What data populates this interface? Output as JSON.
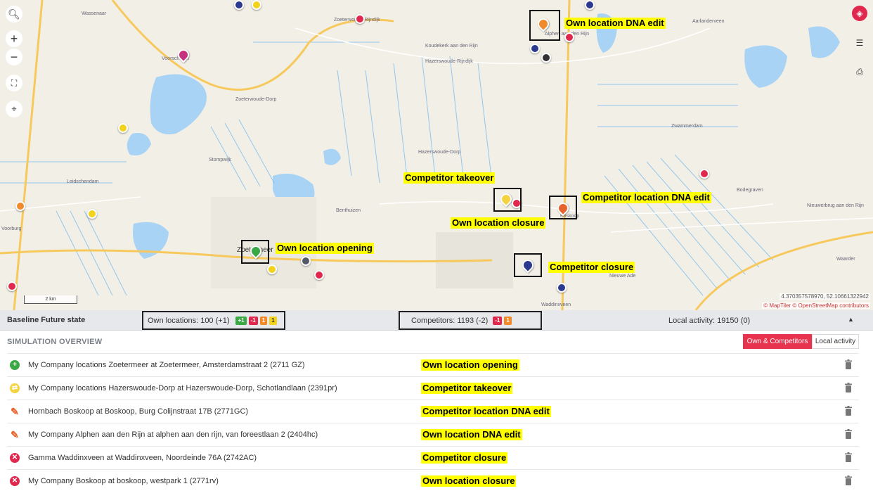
{
  "map": {
    "place_labels": [
      {
        "text": "Wassenaar"
      },
      {
        "text": "Voorschoten"
      },
      {
        "text": "Zoeterwoude-Rijndijk"
      },
      {
        "text": "Zoeterwoude-Dorp"
      },
      {
        "text": "Koudekerk aan den Rijn"
      },
      {
        "text": "Hazerswoude-Rijndijk"
      },
      {
        "text": "Aarlanderveen"
      },
      {
        "text": "Zwammerdam"
      },
      {
        "text": "Hazerswoude-Dorp"
      },
      {
        "text": "Stompwijk"
      },
      {
        "text": "Leidschendam"
      },
      {
        "text": "Voorburg"
      },
      {
        "text": "Benthuizen"
      },
      {
        "text": "Bodegraven"
      },
      {
        "text": "Nieuwerbrug aan den Rijn"
      },
      {
        "text": "Waddinxveen"
      },
      {
        "text": "Nieuwe Ade"
      },
      {
        "text": "Waarder"
      },
      {
        "text": "Boskoop"
      },
      {
        "text": "Alphen aan den Rijn"
      },
      {
        "text": "Zoetermeer"
      }
    ],
    "annotations": {
      "own_dna_edit": "Own location DNA edit",
      "competitor_takeover": "Competitor takeover",
      "competitor_dna_edit": "Competitor location DNA edit",
      "own_closure": "Own location closure",
      "own_opening": "Own location opening",
      "competitor_closure": "Competitor closure"
    },
    "scale_label": "2 km",
    "coordinates": "4.370357578970, 52.10661322942",
    "attribution": "© MapTiler © OpenStreetMap contributors",
    "colors": {
      "water": "#a9d3f5",
      "land": "#f2efe6",
      "road": "#f7c95d",
      "canal": "#6cb6ef"
    }
  },
  "statusbar": {
    "title": "Baseline Future state",
    "own_locations": "Own locations: 100 (+1)",
    "own_badges": [
      {
        "text": "+1",
        "color": "#3aa845"
      },
      {
        "text": "-1",
        "color": "#e0284e"
      },
      {
        "text": "1",
        "color": "#f08a2a"
      },
      {
        "text": "1",
        "color": "#f2d21b"
      }
    ],
    "competitors": "Competitors: 1193 (-2)",
    "competitor_badges": [
      {
        "text": "-1",
        "color": "#e0284e"
      },
      {
        "text": "1",
        "color": "#f08a2a"
      }
    ],
    "local_activity": "Local activity: 19150 (0)",
    "collapse_icon": "▲"
  },
  "overview": {
    "title": "SIMULATION OVERVIEW",
    "toggle_own_competitors": "Own & Competitors",
    "toggle_local_activity": "Local activity",
    "rows": [
      {
        "icon": "plus",
        "icon_symbol": "+",
        "color": "#3aa845",
        "text": "My Company locations Zoetermeer at Zoetermeer, Amsterdamstraat 2 (2711 GZ)",
        "annotation": "Own location opening"
      },
      {
        "icon": "swap",
        "icon_symbol": "⇄",
        "color": "#f4d33e",
        "text": "My Company locations Hazerswoude-Dorp at Hazerswoude-Dorp, Schotlandlaan (2391pr)",
        "annotation": "Competitor takeover"
      },
      {
        "icon": "pencil",
        "icon_symbol": "✎",
        "color": "#e8632b",
        "text": "Hornbach Boskoop at Boskoop, Burg Colijnstraat 17B (2771GC)",
        "annotation": "Competitor location DNA edit"
      },
      {
        "icon": "pencil",
        "icon_symbol": "✎",
        "color": "#e8632b",
        "text": "My Company Alphen aan den Rijn at alphen aan den rijn, van foreestlaan 2 (2404hc)",
        "annotation": "Own location DNA edit"
      },
      {
        "icon": "close",
        "icon_symbol": "✕",
        "color": "#e0284e",
        "text": "Gamma Waddinxveen at Waddinxveen, Noordeinde 76A (2742AC)",
        "annotation": "Competitor closure"
      },
      {
        "icon": "close",
        "icon_symbol": "✕",
        "color": "#e0284e",
        "text": "My Company Boskoop at boskoop, westpark 1 (2771rv)",
        "annotation": "Own location closure"
      }
    ]
  }
}
